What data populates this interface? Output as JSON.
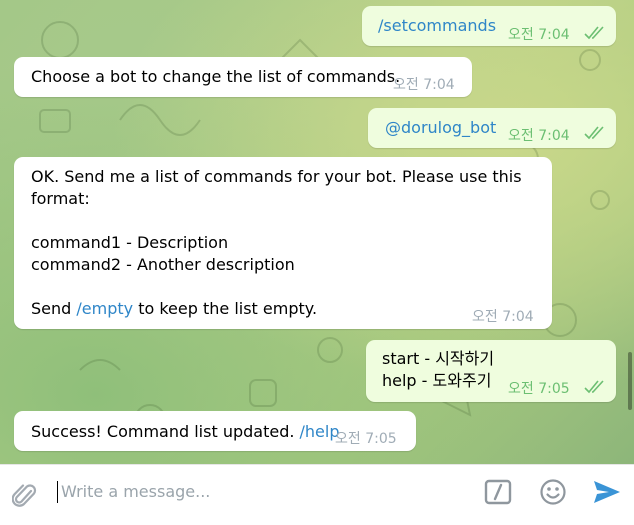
{
  "messages": [
    {
      "id": "m1",
      "dir": "out",
      "text": "/setcommands",
      "time": "오전 7:04"
    },
    {
      "id": "m2",
      "dir": "in",
      "text": "Choose a bot to change the list of commands.",
      "time": "오전 7:04"
    },
    {
      "id": "m3",
      "dir": "out",
      "text": "@dorulog_bot",
      "time": "오전 7:04"
    },
    {
      "id": "m4",
      "dir": "in",
      "lines": [
        "OK. Send me a list of commands for your bot. Please use this",
        "format:",
        "",
        "command1 - Description",
        "command2 - Another description",
        "",
        "Send ",
        "/empty",
        " to keep the list empty."
      ],
      "time": "오전 7:04"
    },
    {
      "id": "m5",
      "dir": "out",
      "lines": [
        "start - 시작하기",
        "help - 도와주기"
      ],
      "time": "오전 7:05"
    },
    {
      "id": "m6",
      "dir": "in",
      "text": "Success! Command list updated. ",
      "link": "/help",
      "time": "오전 7:05"
    }
  ],
  "composer": {
    "placeholder": "Write a message..."
  },
  "icons": {
    "attach": "paperclip-icon",
    "commands": "slash-command-icon",
    "emoji": "smile-icon",
    "send": "send-arrow-icon",
    "read": "double-check-icon"
  },
  "colors": {
    "outgoing_bubble": "#effdde",
    "incoming_bubble": "#ffffff",
    "link": "#2f86c8",
    "send": "#3a94d6",
    "check": "#6cbf72"
  }
}
